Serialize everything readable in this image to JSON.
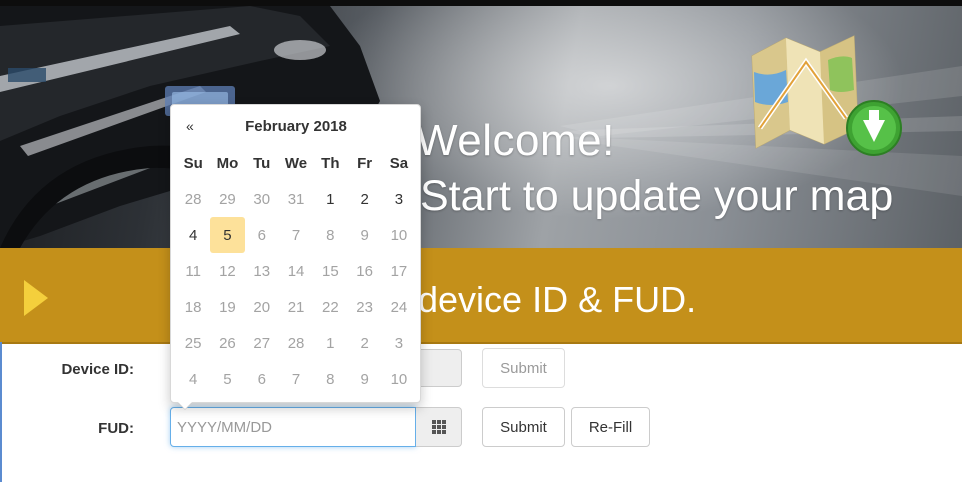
{
  "hero": {
    "welcome": "Welcome!",
    "subtitle": "Start to update your map"
  },
  "band": {
    "text": "device ID & FUD."
  },
  "form": {
    "device_label": "Device ID:",
    "device_value": "",
    "device_submit": "Submit",
    "fud_label": "FUD:",
    "fud_value": "",
    "fud_placeholder": "YYYY/MM/DD",
    "fud_submit": "Submit",
    "fud_refill": "Re-Fill",
    "calendar_icon": "calendar-grid-icon"
  },
  "datepicker": {
    "prev": "«",
    "title": "February 2018",
    "weekdays": [
      "Su",
      "Mo",
      "Tu",
      "We",
      "Th",
      "Fr",
      "Sa"
    ],
    "weeks": [
      [
        "28",
        "29",
        "30",
        "31",
        "1",
        "2",
        "3"
      ],
      [
        "4",
        "5",
        "6",
        "7",
        "8",
        "9",
        "10"
      ],
      [
        "11",
        "12",
        "13",
        "14",
        "15",
        "16",
        "17"
      ],
      [
        "18",
        "19",
        "20",
        "21",
        "22",
        "23",
        "24"
      ],
      [
        "25",
        "26",
        "27",
        "28",
        "1",
        "2",
        "3"
      ],
      [
        "4",
        "5",
        "6",
        "7",
        "8",
        "9",
        "10"
      ]
    ],
    "muted": [
      [
        true,
        true,
        true,
        true,
        false,
        false,
        false
      ],
      [
        false,
        false,
        true,
        true,
        true,
        true,
        true
      ],
      [
        true,
        true,
        true,
        true,
        true,
        true,
        true
      ],
      [
        true,
        true,
        true,
        true,
        true,
        true,
        true
      ],
      [
        true,
        true,
        true,
        true,
        true,
        true,
        true
      ],
      [
        true,
        true,
        true,
        true,
        true,
        true,
        true
      ]
    ],
    "today": "5"
  },
  "colors": {
    "band": "#c4901a",
    "band_arrow": "#f4cf3c",
    "today_highlight": "#fde19a",
    "focus_border": "#66afe9"
  },
  "icons": {
    "band_arrow": "play-triangle-icon",
    "map": "map-download-icon"
  }
}
